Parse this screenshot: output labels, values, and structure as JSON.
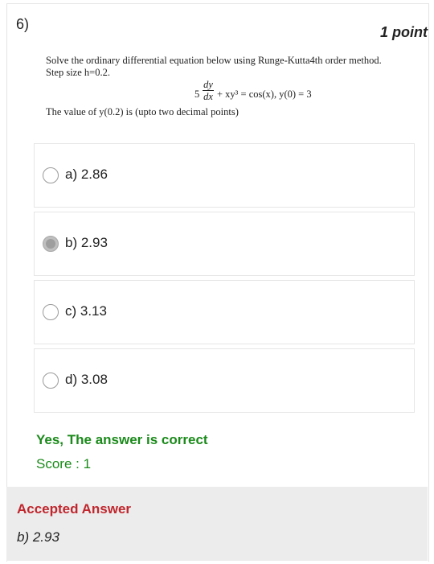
{
  "question": {
    "number": "6)",
    "points": "1 point",
    "text_line1": "Solve the ordinary differential equation below using Runge-Kutta4th order method.",
    "text_line2": "Step size h=0.2.",
    "equation": {
      "coefficient": "5",
      "numerator": "dy",
      "denominator": "dx",
      "rest": "+ xy³ = cos(x), y(0) = 3"
    },
    "prompt": "The value of y(0.2) is (upto two decimal points)"
  },
  "options": [
    {
      "label": "a) 2.86",
      "selected": false
    },
    {
      "label": "b) 2.93",
      "selected": true
    },
    {
      "label": "c) 3.13",
      "selected": false
    },
    {
      "label": "d) 3.08",
      "selected": false
    }
  ],
  "result": {
    "feedback": "Yes, The answer is correct",
    "score": "Score : 1"
  },
  "accepted": {
    "title": "Accepted Answer",
    "value": "b) 2.93"
  },
  "colors": {
    "correct": "#1b8a1b",
    "accepted_title": "#c0262d",
    "panel_bg": "#ececec"
  }
}
